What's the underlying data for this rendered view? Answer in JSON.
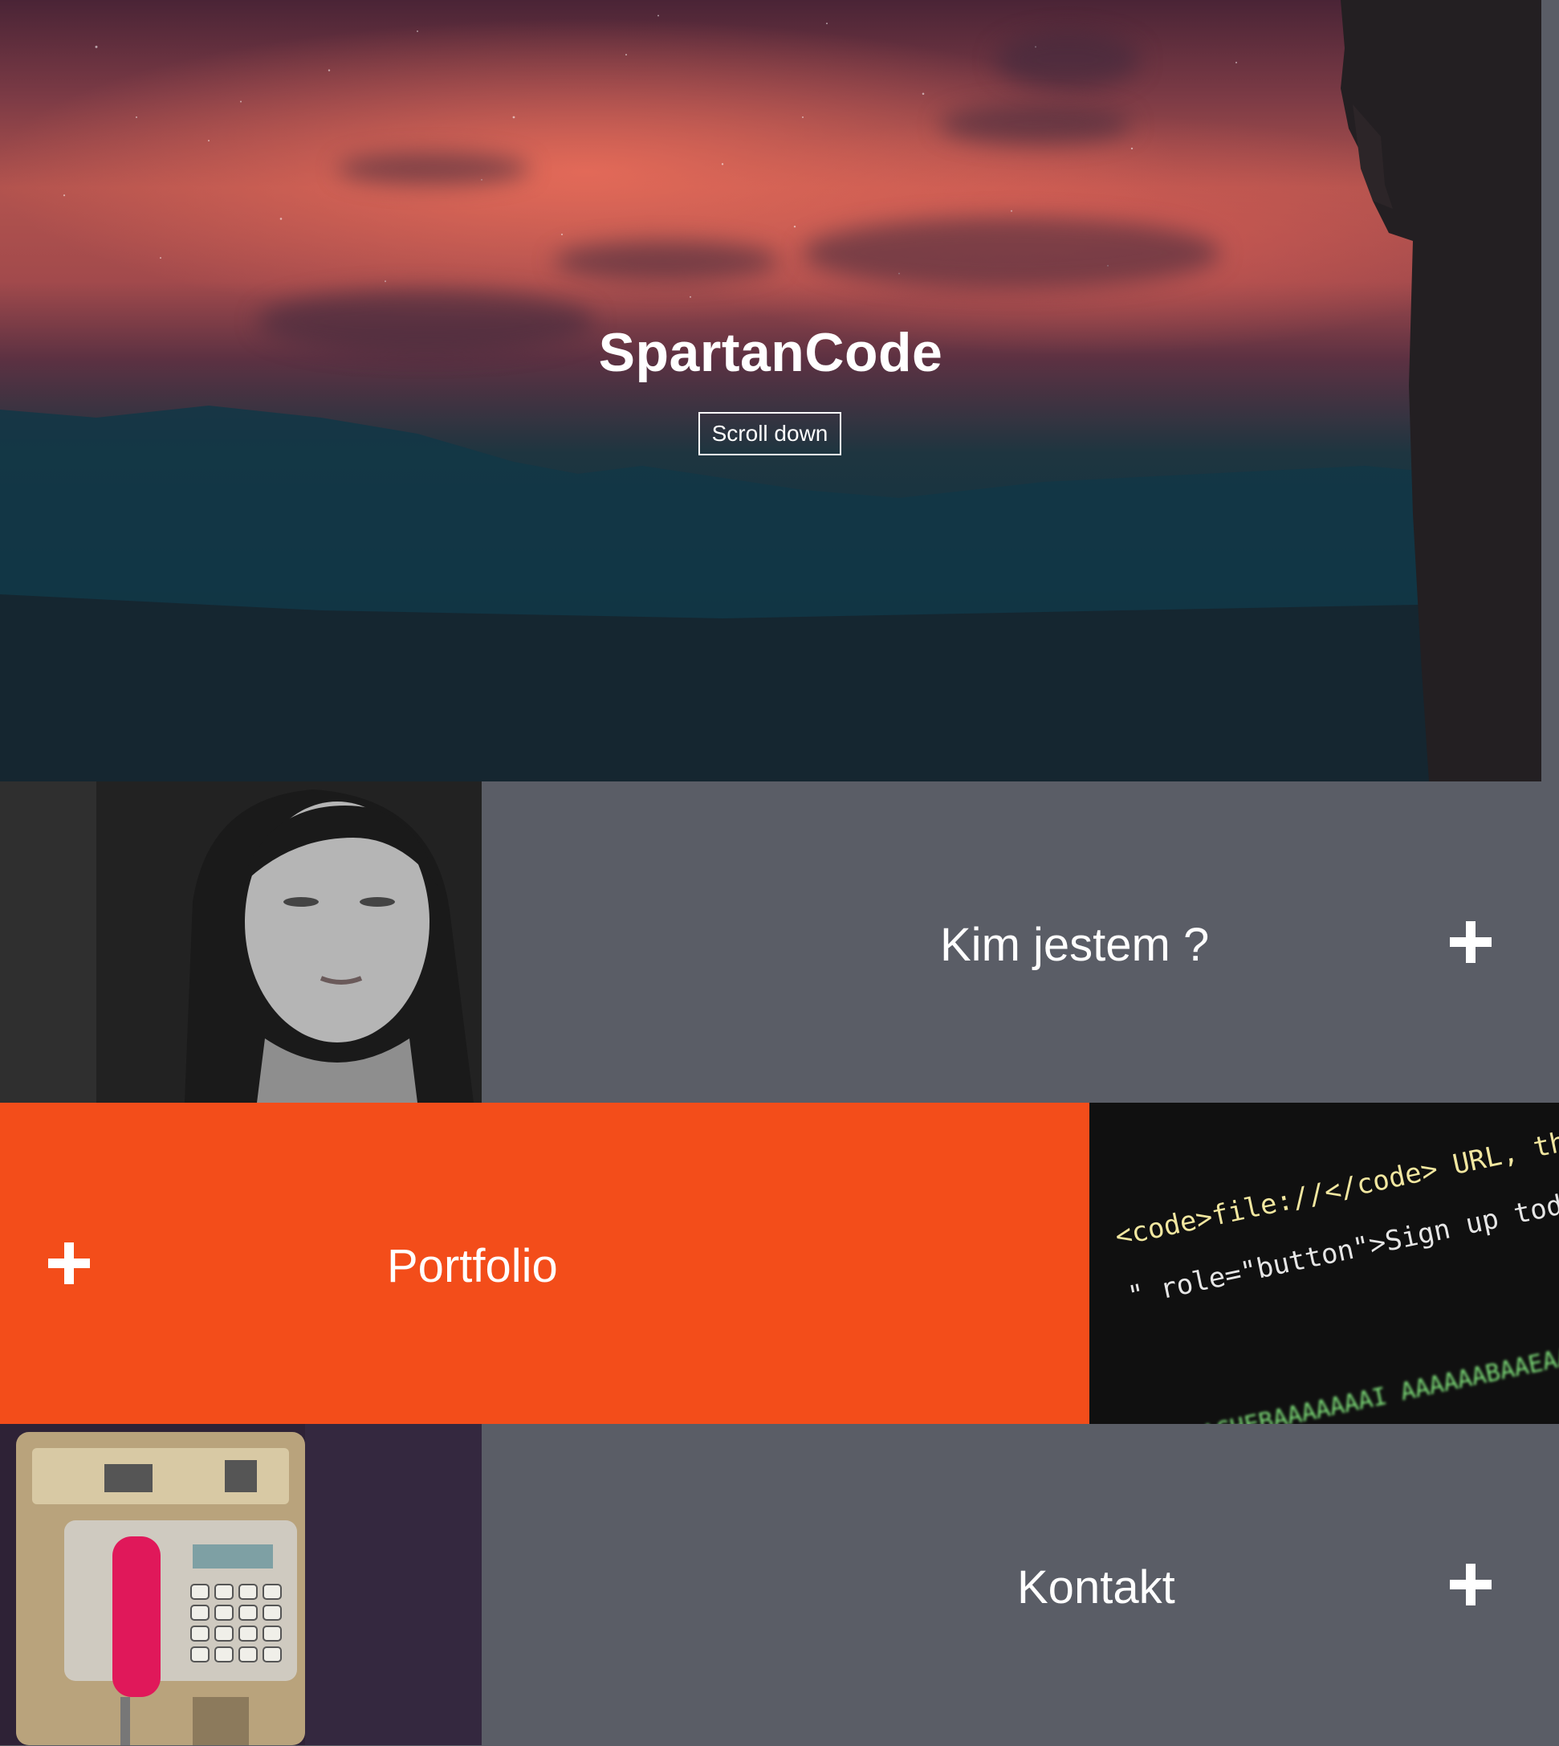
{
  "hero": {
    "title": "SpartanCode",
    "scroll_label": "Scroll down"
  },
  "sections": [
    {
      "label": "Kim jestem ?",
      "icon": "plus-icon"
    },
    {
      "label": "Portfolio",
      "icon": "plus-icon"
    },
    {
      "label": "Kontakt",
      "icon": "plus-icon"
    }
  ],
  "code_photo": {
    "line1": "<code>file://</code> URL, the \"next\"",
    "line2": "\" role=\"button\">Sign up today</a></p>",
    "line3": "...ACHEBAAAAAAAI AAAAAABAAEAAAIC"
  },
  "colors": {
    "accent": "#f34d1a",
    "panel": "#5a5d66",
    "text": "#ffffff"
  }
}
